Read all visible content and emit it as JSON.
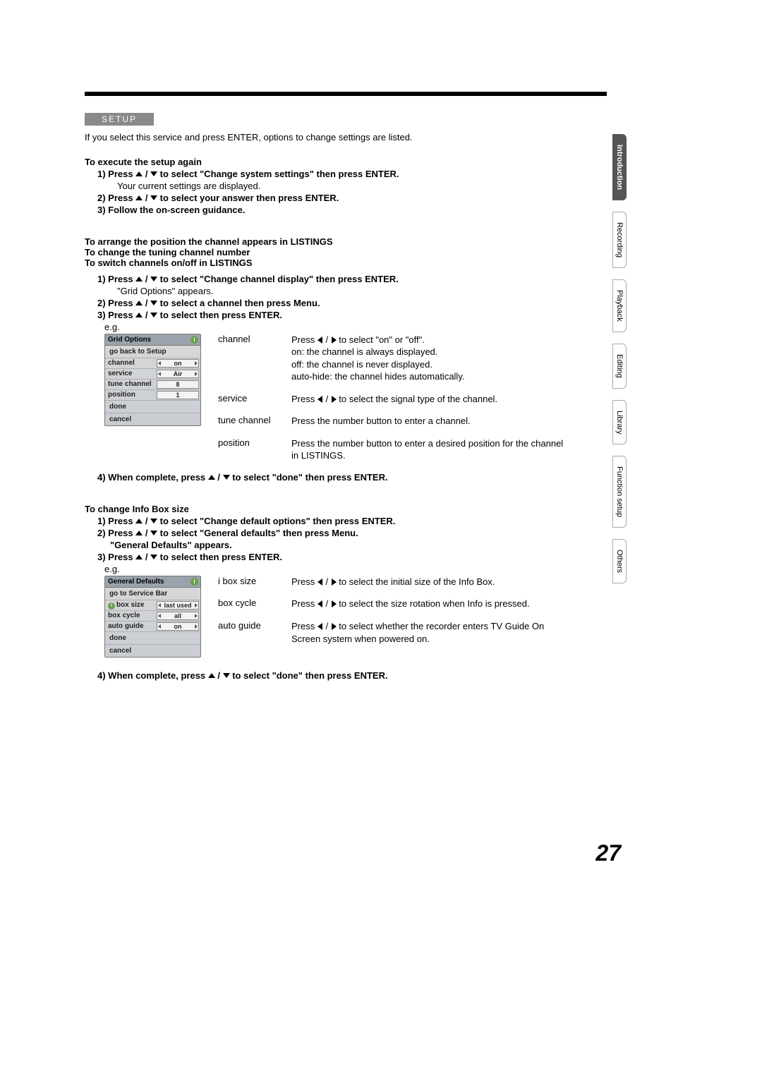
{
  "setup_label": "SETUP",
  "intro": "If you select this service and press ENTER, options to change settings are listed.",
  "sec_exec": {
    "heading": "To execute the setup again",
    "s1a": "1)  Press ",
    "s1b": " / ",
    "s1c": " to select \"Change system settings\" then press ENTER.",
    "s1_note": "Your current settings are displayed.",
    "s2a": "2)  Press ",
    "s2b": " / ",
    "s2c": " to select your answer then press ENTER.",
    "s3": "3)  Follow the on-screen guidance."
  },
  "sec_arrange": {
    "h1": "To arrange the position the channel appears in LISTINGS",
    "h2": "To change the tuning channel number",
    "h3": "To switch channels on/off in LISTINGS",
    "s1a": "1)  Press ",
    "s1b": " / ",
    "s1c": " to select \"Change channel display\" then press ENTER.",
    "s1_note": "\"Grid Options\" appears.",
    "s2a": "2)  Press ",
    "s2b": " / ",
    "s2c": " to select a channel then press Menu.",
    "s3a": "3)  Press ",
    "s3b": " / ",
    "s3c": " to select then press ENTER.",
    "eg": "e.g."
  },
  "grid_panel": {
    "title": "Grid Options",
    "r_back": "go back to Setup",
    "r_channel": "channel",
    "v_channel": "on",
    "r_service": "service",
    "v_service": "Air",
    "r_tune": "tune channel",
    "v_tune": "8",
    "r_pos": "position",
    "v_pos": "1",
    "r_done": "done",
    "r_cancel": "cancel"
  },
  "grid_desc": {
    "k_channel": "channel",
    "v_channel_1a": "Press ",
    "v_channel_1b": " / ",
    "v_channel_1c": " to select \"on\" or \"off\".",
    "v_channel_2": "on: the channel is always displayed.",
    "v_channel_3": "off: the channel is never displayed.",
    "v_channel_4": "auto-hide: the channel hides automatically.",
    "k_service": "service",
    "v_service_a": "Press ",
    "v_service_b": " / ",
    "v_service_c": " to select the signal type of the channel.",
    "k_tune": "tune channel",
    "v_tune": "Press the number button to enter a channel.",
    "k_pos": "position",
    "v_pos": "Press the number button to enter a desired position for the channel in LISTINGS."
  },
  "sec_arrange_done_a": "4)  When complete, press ",
  "sec_arrange_done_b": " / ",
  "sec_arrange_done_c": " to select \"done\" then press ENTER.",
  "sec_info": {
    "heading": "To change Info Box size",
    "s1a": "1)  Press ",
    "s1b": " / ",
    "s1c": " to select \"Change default options\" then press ENTER.",
    "s2a": "2)  Press ",
    "s2b": " / ",
    "s2c": " to select \"General defaults\" then press Menu.",
    "s2_note": "\"General Defaults\" appears.",
    "s3a": "3)  Press ",
    "s3b": " / ",
    "s3c": " to select then press ENTER.",
    "eg": "e.g."
  },
  "gen_panel": {
    "title": "General Defaults",
    "r_back": "go to Service Bar",
    "r_box": "box size",
    "v_box": "last used",
    "r_cycle": "box cycle",
    "v_cycle": "all",
    "r_auto": "auto guide",
    "v_auto": "on",
    "r_done": "done",
    "r_cancel": "cancel"
  },
  "gen_desc": {
    "k_box": "i box size",
    "v_box_a": "Press ",
    "v_box_b": " / ",
    "v_box_c": " to select the initial size of the Info Box.",
    "k_cycle": "box cycle",
    "v_cycle_a": "Press ",
    "v_cycle_b": " / ",
    "v_cycle_c": " to select the size rotation when Info is pressed.",
    "k_auto": "auto guide",
    "v_auto_a": "Press ",
    "v_auto_b": " / ",
    "v_auto_c": " to select whether the recorder enters TV Guide On Screen system when powered on."
  },
  "sec_info_done_a": "4)  When complete, press ",
  "sec_info_done_b": " / ",
  "sec_info_done_c": " to select \"done\" then press ENTER.",
  "tabs": {
    "intro": "Introduction",
    "rec": "Recording",
    "play": "Playback",
    "edit": "Editing",
    "lib": "Library",
    "func": "Function setup",
    "others": "Others"
  },
  "page": "27"
}
